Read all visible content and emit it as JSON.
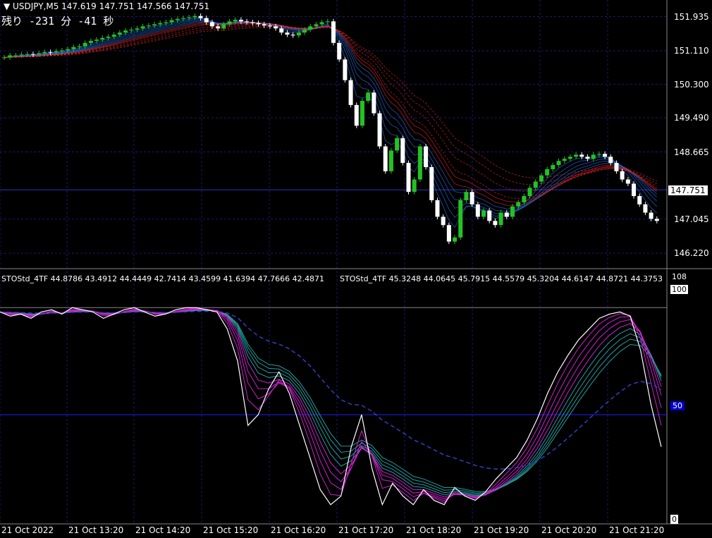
{
  "window": {
    "symbol_line": "USDJPY,M5  147.619 147.751 147.566 147.751",
    "timer_text": "残り -231 分 -41 秒"
  },
  "price_panel": {
    "ticks": [
      "151.935",
      "151.110",
      "150.300",
      "149.490",
      "148.665",
      "147.045",
      "146.220"
    ],
    "current_price": "147.751"
  },
  "osc_panel": {
    "header_1": "STOStd_4TF 44.8786 43.4912 44.4449 42.7414 43.4599 41.6394 47.7666 42.4871",
    "header_2": "STOStd_4TF 45.3248 44.0645 45.7915 44.5579 45.3204 44.6147 44.8721 44.3753",
    "scale_top": "108",
    "scale_100": "100",
    "scale_mid": "50",
    "scale_bottom": "0"
  },
  "time_axis": [
    "21 Oct 2022",
    "21 Oct 13:20",
    "21 Oct 14:20",
    "21 Oct 15:20",
    "21 Oct 16:20",
    "21 Oct 17:20",
    "21 Oct 18:20",
    "21 Oct 19:20",
    "21 Oct 20:20",
    "21 Oct 21:20"
  ],
  "colors": {
    "background": "#000000",
    "grid": "#1a1a6e",
    "bull": "#22c322",
    "bear": "#ffffff",
    "band_up": "#2a7fff",
    "band_down": "#ff2a2a",
    "osc_main": "#ffffff",
    "osc_ribbon_a": "#d020d0",
    "osc_ribbon_b": "#20a0a0"
  },
  "chart_data": [
    {
      "type": "candlestick",
      "title": "USDJPY,M5",
      "ylim": [
        146.0,
        152.2
      ],
      "y_ticks": [
        151.935,
        151.11,
        150.3,
        149.49,
        148.665,
        147.045,
        146.22
      ],
      "current_price": 147.751,
      "close_series": [
        150.95,
        151.0,
        151.0,
        151.02,
        151.03,
        151.02,
        151.05,
        151.08,
        151.07,
        151.1,
        151.12,
        151.15,
        151.2,
        151.22,
        151.3,
        151.35,
        151.38,
        151.42,
        151.45,
        151.5,
        151.55,
        151.6,
        151.62,
        151.65,
        151.7,
        151.72,
        151.75,
        151.78,
        151.8,
        151.85,
        151.88,
        151.9,
        151.92,
        151.95,
        151.9,
        151.8,
        151.7,
        151.65,
        151.75,
        151.82,
        151.86,
        151.82,
        151.8,
        151.78,
        151.75,
        151.72,
        151.7,
        151.65,
        151.55,
        151.5,
        151.48,
        151.55,
        151.62,
        151.7,
        151.75,
        151.8,
        151.82,
        151.3,
        150.9,
        150.4,
        149.8,
        149.3,
        149.9,
        150.1,
        149.6,
        148.8,
        148.2,
        148.7,
        149.0,
        148.4,
        147.7,
        148.0,
        148.8,
        148.3,
        147.5,
        147.1,
        146.9,
        146.5,
        146.6,
        147.5,
        147.7,
        147.4,
        147.1,
        147.25,
        147.0,
        146.9,
        147.2,
        147.1,
        147.35,
        147.45,
        147.6,
        147.8,
        147.95,
        148.1,
        148.25,
        148.35,
        148.45,
        148.5,
        148.55,
        148.6,
        148.55,
        148.5,
        148.6,
        148.62,
        148.55,
        148.4,
        148.2,
        148.0,
        147.9,
        147.6,
        147.4,
        147.2,
        147.05,
        147.0
      ]
    },
    {
      "type": "line",
      "title": "STOStd_4TF",
      "ylim": [
        0,
        108
      ],
      "y_ticks": [
        0,
        50,
        100
      ],
      "series": [
        {
          "name": "STOStd_4TF",
          "values": [
            98,
            96,
            97,
            95,
            98,
            99,
            97,
            100,
            99,
            98,
            95,
            97,
            99,
            100,
            98,
            96,
            97,
            99,
            100,
            100,
            99,
            98,
            90,
            75,
            45,
            50,
            62,
            70,
            60,
            45,
            30,
            15,
            8,
            12,
            35,
            50,
            25,
            8,
            18,
            12,
            8,
            15,
            10,
            8,
            16,
            12,
            10,
            14,
            20,
            25,
            30,
            38,
            48,
            60,
            70,
            78,
            85,
            90,
            95,
            97,
            98,
            96,
            80,
            55,
            35
          ]
        }
      ]
    }
  ]
}
